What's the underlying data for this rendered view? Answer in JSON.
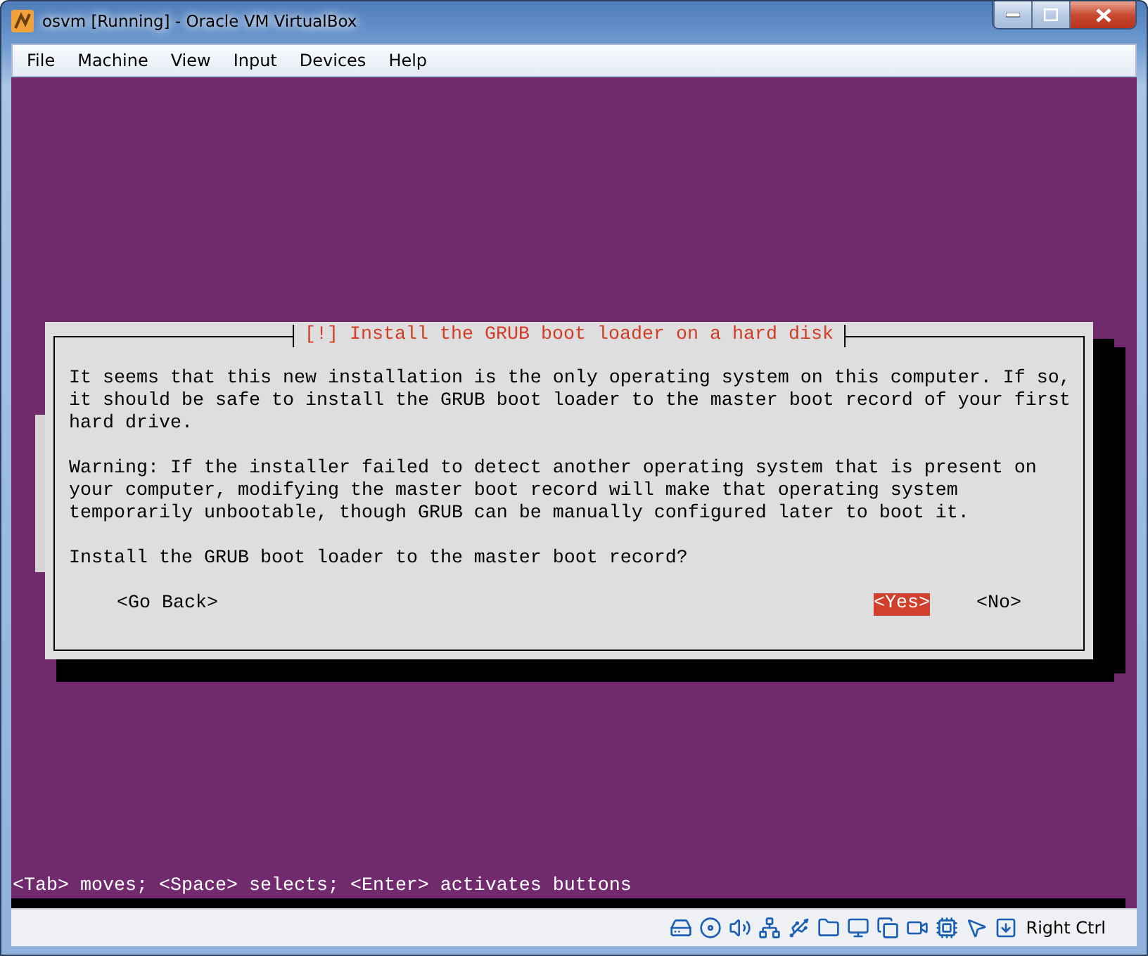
{
  "window": {
    "title": "osvm [Running] - Oracle VM VirtualBox"
  },
  "menu": [
    "File",
    "Machine",
    "View",
    "Input",
    "Devices",
    "Help"
  ],
  "dialog": {
    "title": "[!] Install the GRUB boot loader on a hard disk",
    "paragraphs": [
      [
        "It seems that this new installation is the only operating system on this computer. If so,",
        "it should be safe to install the GRUB boot loader to the master boot record of your first",
        "hard drive."
      ],
      [
        "Warning: If the installer failed to detect another operating system that is present on",
        "your computer, modifying the master boot record will make that operating system",
        "temporarily unbootable, though GRUB can be manually configured later to boot it."
      ],
      [
        "Install the GRUB boot loader to the master boot record?"
      ]
    ],
    "buttons": [
      {
        "label": "<Go Back>",
        "selected": false
      },
      {
        "label": "<Yes>",
        "selected": true
      },
      {
        "label": "<No>",
        "selected": false
      }
    ]
  },
  "hint": "<Tab> moves; <Space> selects; <Enter> activates buttons",
  "status_bar": {
    "host_key": "Right Ctrl"
  }
}
